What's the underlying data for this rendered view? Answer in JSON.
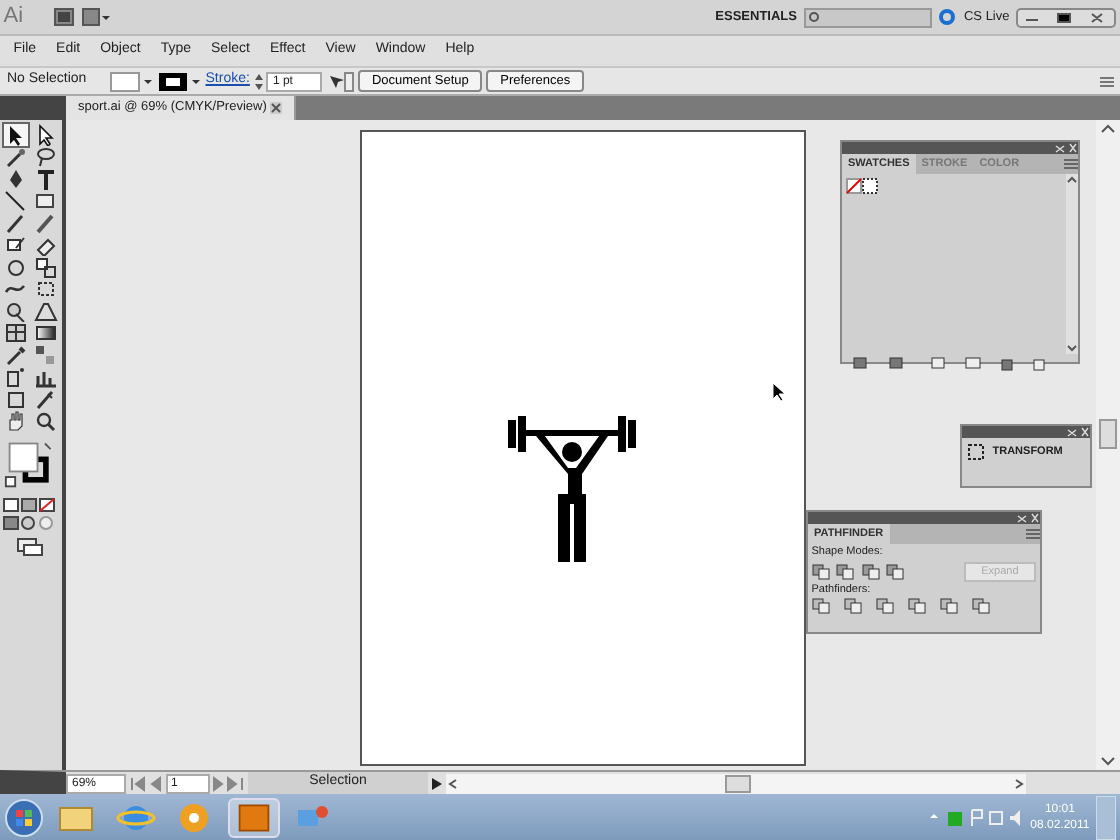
{
  "app_bar": {
    "logo": "Ai",
    "workspace": "ESSENTIALS",
    "cs_live": "CS Live"
  },
  "menu": [
    "File",
    "Edit",
    "Object",
    "Type",
    "Select",
    "Effect",
    "View",
    "Window",
    "Help"
  ],
  "control_bar": {
    "selection": "No Selection",
    "stroke_label": "Stroke:",
    "stroke_value": "1 pt",
    "buttons": [
      "Document Setup",
      "Preferences"
    ]
  },
  "document_tab": {
    "title": "sport.ai @ 69% (CMYK/Preview)",
    "selected": true
  },
  "swatches_panel": {
    "tabs": [
      {
        "label": "SWATCHES",
        "selected": true
      },
      {
        "label": "STROKE",
        "selected": false
      },
      {
        "label": "COLOR",
        "selected": false
      }
    ]
  },
  "transform_panel": {
    "label": "TRANSFORM"
  },
  "pathfinder_panel": {
    "tabs": [
      {
        "label": "PATHFINDER",
        "selected": true
      }
    ],
    "shape_modes_label": "Shape Modes:",
    "expand_button": {
      "label": "Expand",
      "disabled": true
    },
    "pathfinders_label": "Pathfinders:"
  },
  "status_bar": {
    "zoom": "69%",
    "page": "1",
    "tool": "Selection"
  },
  "taskbar": {
    "time": "10:01",
    "date": "08.02.2011"
  }
}
